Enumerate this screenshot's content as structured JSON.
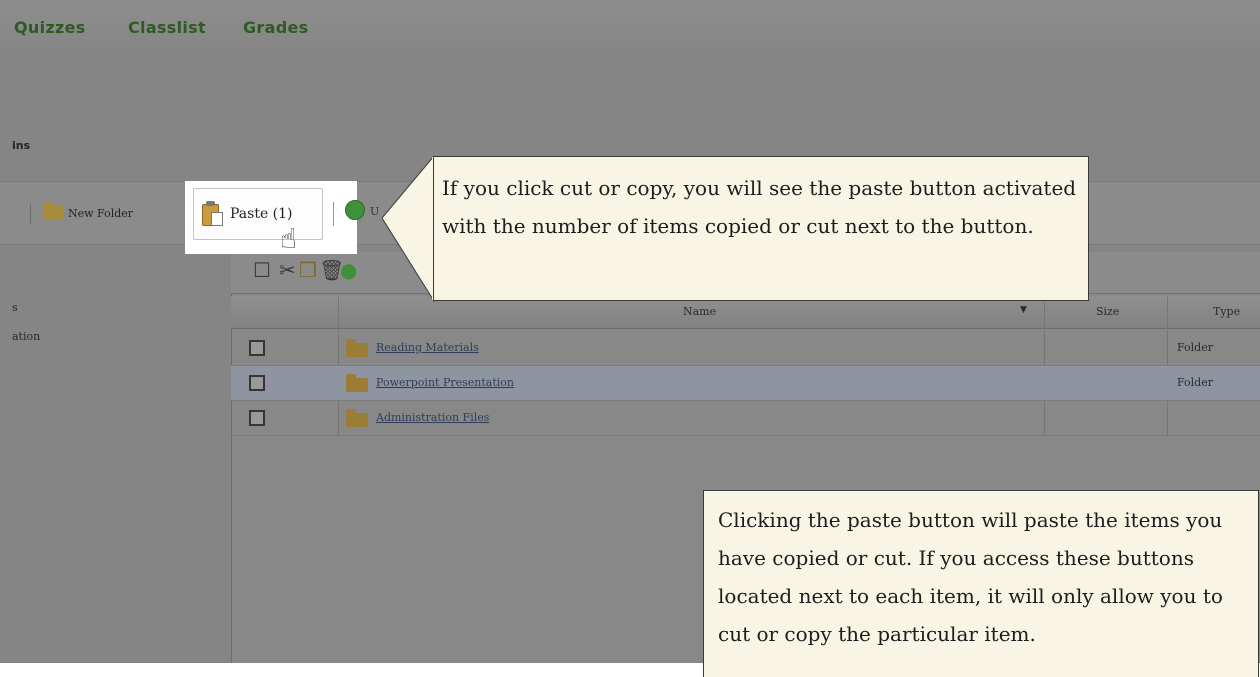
{
  "nav": {
    "quizzes": "Quizzes",
    "classlist": "Classlist",
    "grades": "Grades"
  },
  "page": {
    "title_fragment": "ins"
  },
  "toolbar": {
    "new_folder_label": "New Folder",
    "paste_label": "Paste (1)",
    "upload_stub": "U"
  },
  "sidebar": {
    "item_a": "s",
    "item_b": "ation"
  },
  "table": {
    "columns": {
      "name": "Name",
      "size": "Size",
      "type": "Type"
    },
    "rows": [
      {
        "name": "Reading Materials",
        "type": "Folder"
      },
      {
        "name": "Powerpoint Presentation",
        "type": "Folder"
      },
      {
        "name": "Administration Files",
        "type": ""
      }
    ]
  },
  "callouts": {
    "top": "If you click cut or copy, you will see the paste button activated with the number of items copied or cut next to the button.",
    "bottom": "Clicking the paste button will paste the items you have copied or cut. If you access these buttons located next to each item, it will only allow you to cut or copy the particular item."
  },
  "colors": {
    "nav_link": "#2e5a23",
    "callout_bg": "#f8f5e5",
    "overlay_gray": "#858585"
  }
}
